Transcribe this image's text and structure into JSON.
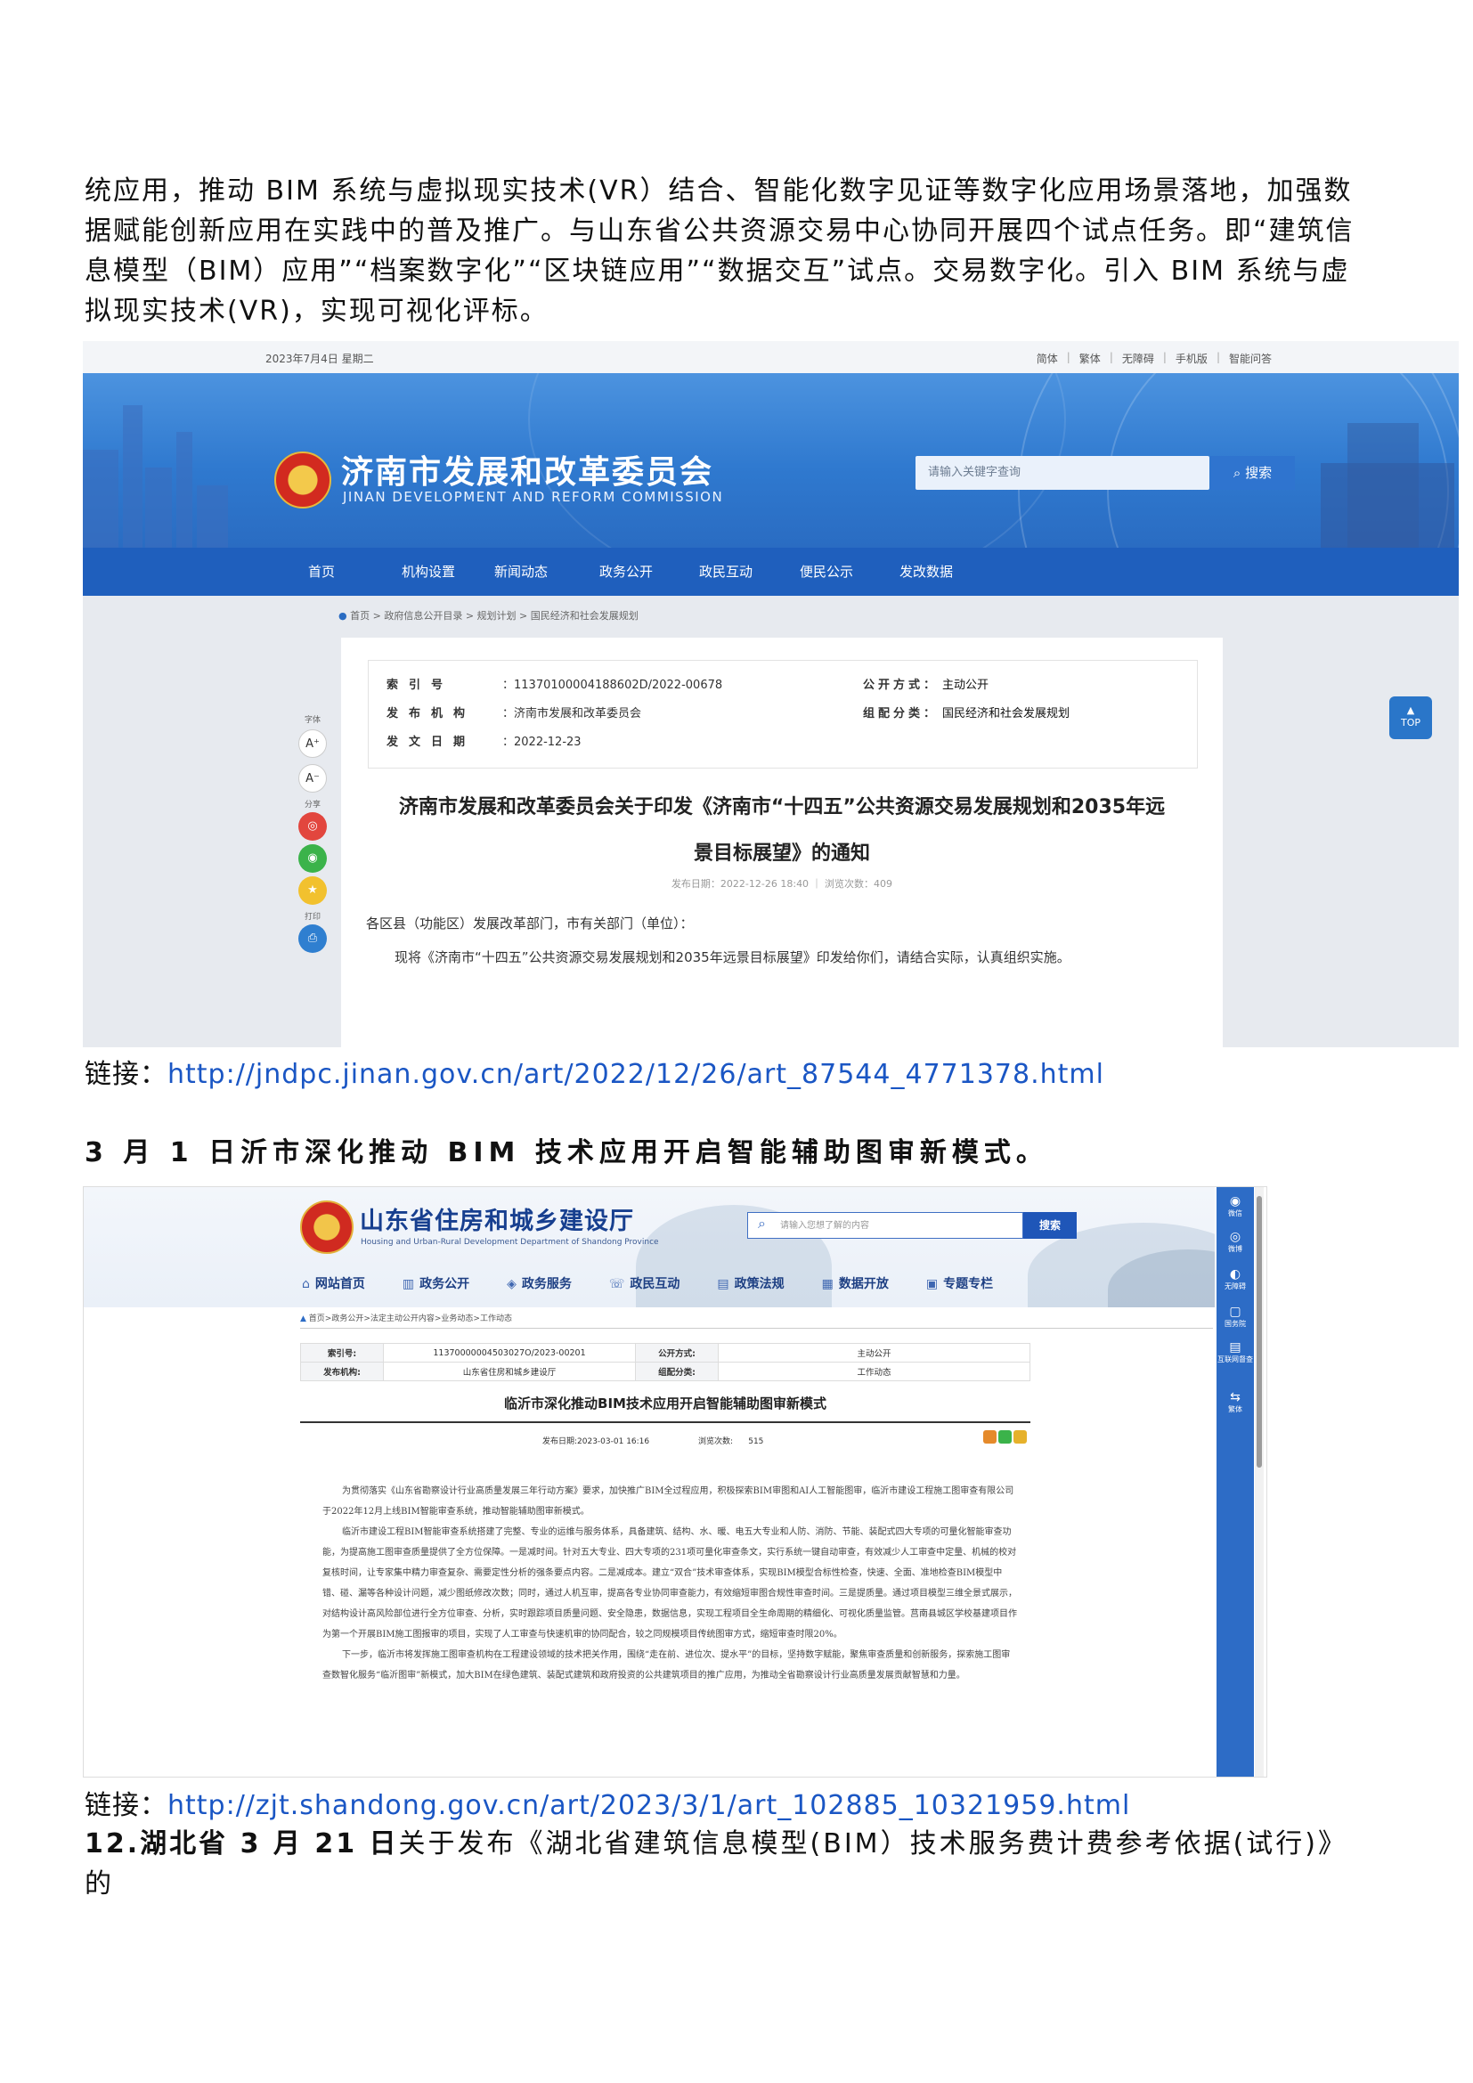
{
  "doc": {
    "para1": "统应用，推动 BIM 系统与虚拟现实技术(VR）结合、智能化数字见证等数字化应用场景落地，加强数据赋能创新应用在实践中的普及推广。与山东省公共资源交易中心协同开展四个试点任务。即“建筑信息模型（BIM）应用”“档案数字化”“区块链应用”“数据交互”试点。交易数字化。引入 BIM 系统与虚拟现实技术(VR)，实现可视化评标。",
    "link_label": "链接：",
    "link1": "http://jndpc.jinan.gov.cn/art/2022/12/26/art_87544_4771378.html",
    "heading2": "3 月 1 日沂市深化推动 BIM 技术应用开启智能辅助图审新模式。",
    "link2": "http://zjt.shandong.gov.cn/art/2023/3/1/art_102885_10321959.html",
    "para3_bold": "12.湖北省 3 月 21 日",
    "para3_rest": "关于发布《湖北省建筑信息模型(BIM）技术服务费计费参考依据(试行)》的"
  },
  "shot1": {
    "date": "2023年7月4日 星期二",
    "util": [
      "简体",
      "繁体",
      "无障碍",
      "手机版",
      "智能问答"
    ],
    "site_title": "济南市发展和改革委员会",
    "site_subtitle": "JINAN DEVELOPMENT AND REFORM COMMISSION",
    "search_placeholder": "请输入关键字查询",
    "search_button": "搜索",
    "nav": [
      "首页",
      "机构设置",
      "新闻动态",
      "政务公开",
      "政民互动",
      "便民公示",
      "发改数据"
    ],
    "breadcrumb": "首页 > 政府信息公开目录 > 规划计划 > 国民经济和社会发展规划",
    "meta": {
      "index_key": "索引号",
      "index_val": "：11370100004188602D/2022-00678",
      "org_key": "发布机构",
      "org_val": "：济南市发展和改革委员会",
      "date_key": "发文日期",
      "date_val": "：2022-12-23",
      "open_key": "公开方式：",
      "open_val": "主动公开",
      "cat_key": "组配分类：",
      "cat_val": "国民经济和社会发展规划"
    },
    "headline_line1": "济南市发展和改革委员会关于印发《济南市“十四五”公共资源交易发展规划和2035年远",
    "headline_line2": "景目标展望》的通知",
    "pubinfo": "发布日期：2022-12-26 18:40 ｜ 浏览次数：409",
    "body_line1": "各区县（功能区）发展改革部门，市有关部门（单位）：",
    "body_line2": "现将《济南市“十四五”公共资源交易发展规划和2035年远景目标展望》印发给你们，请结合实际，认真组织实施。",
    "side_font": "字体",
    "side_share": "分享",
    "side_print": "打印",
    "font_up": "A⁺",
    "font_down": "A⁻",
    "top_label": "TOP"
  },
  "shot2": {
    "site_title": "山东省住房和城乡建设厅",
    "site_subtitle": "Housing and Urban-Rural Development Department of Shandong Province",
    "search_placeholder": "请输入您想了解的内容",
    "search_button": "搜索",
    "nav": [
      {
        "icon": "⌂",
        "label": "网站首页"
      },
      {
        "icon": "▥",
        "label": "政务公开"
      },
      {
        "icon": "◈",
        "label": "政务服务"
      },
      {
        "icon": "☏",
        "label": "政民互动"
      },
      {
        "icon": "▤",
        "label": "政策法规"
      },
      {
        "icon": "▦",
        "label": "数据开放"
      },
      {
        "icon": "▣",
        "label": "专题专栏"
      }
    ],
    "breadcrumb": "首页>政务公开>法定主动公开内容>业务动态>工作动态",
    "meta": {
      "index_key": "索引号:",
      "index_val": "11370000004503027O/2023-00201",
      "open_key": "公开方式:",
      "open_val": "主动公开",
      "org_key": "发布机构:",
      "org_val": "山东省住房和城乡建设厅",
      "cat_key": "组配分类:",
      "cat_val": "工作动态"
    },
    "headline": "临沂市深化推动BIM技术应用开启智能辅助图审新模式",
    "pubdate": "发布日期:2023-03-01 16:16",
    "views_label": "浏览次数:",
    "views": "515",
    "body": [
      "为贯彻落实《山东省勘察设计行业高质量发展三年行动方案》要求，加快推广BIM全过程应用，积极探索BIM审图和AI人工智能图审，临沂市建设工程施工图审查有限公司于2022年12月上线BIM智能审查系统，推动智能辅助图审新模式。",
      "临沂市建设工程BIM智能审查系统搭建了完整、专业的运维与服务体系，具备建筑、结构、水、暖、电五大专业和人防、消防、节能、装配式四大专项的可量化智能审查功能，为提高施工图审查质量提供了全方位保障。一是减时间。针对五大专业、四大专项的231项可量化审查条文，实行系统一键自动审查，有效减少人工审查中定量、机械的校对复核时间，让专家集中精力审查复杂、需要定性分析的强条要点内容。二是减成本。建立“双合”技术审查体系，实现BIM模型合标性检查，快速、全面、准地检查BIM模型中错、碰、漏等各种设计问题，减少图纸修改次数；同时，通过人机互审，提高各专业协同审查能力，有效缩短审图合规性审查时间。三是提质量。通过项目模型三维全景式展示，对结构设计高风险部位进行全方位审查、分析，实时跟踪项目质量问题、安全隐患，数据信息，实现工程项目全生命周期的精细化、可视化质量监管。莒南县城区学校基建项目作为第一个开展BIM施工图报审的项目，实现了人工审查与快速机审的协同配合，较之同规模项目传统图审方式，缩短审查时限20%。",
      "下一步，临沂市将发挥施工图审查机构在工程建设领域的技术把关作用，围绕“走在前、进位次、提水平”的目标，坚持数字赋能，聚焦审查质量和创新服务，探索施工图审查数智化服务“临沂图审”新模式，加大BIM在绿色建筑、装配式建筑和政府投资的公共建筑项目的推广应用，为推动全省勘察设计行业高质量发展贡献智慧和力量。"
    ],
    "rightbar": [
      {
        "icon": "◉",
        "label": "微信"
      },
      {
        "icon": "◎",
        "label": "微博"
      },
      {
        "icon": "◐",
        "label": "无障碍"
      },
      {
        "icon": "▢",
        "label": "国务院"
      },
      {
        "icon": "▤",
        "label": "互联网督查"
      },
      {
        "icon": "⇆",
        "label": "繁体"
      }
    ]
  }
}
